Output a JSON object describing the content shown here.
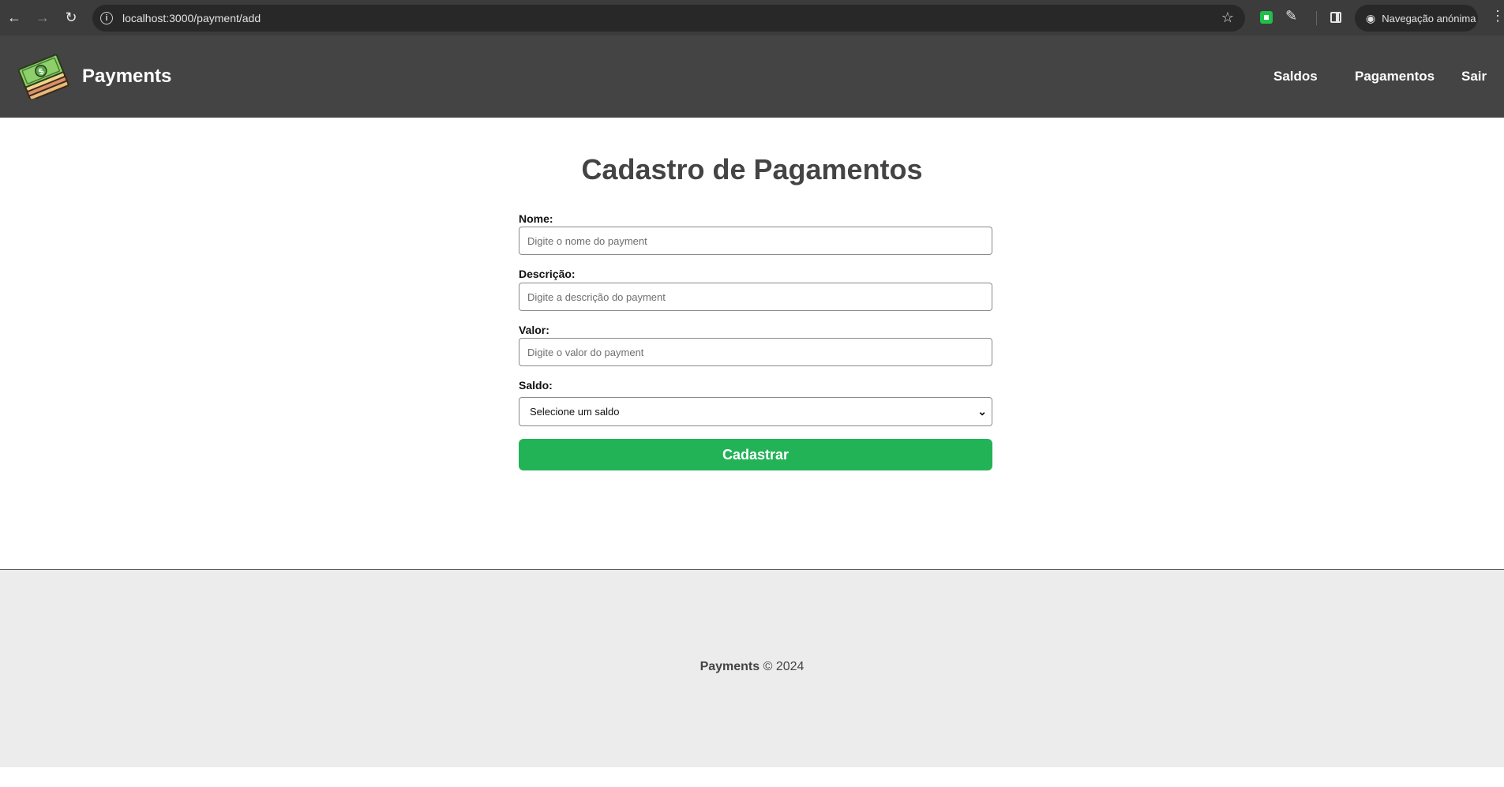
{
  "browser": {
    "url": "localhost:3000/payment/add",
    "profile_label": "Navegação anónima",
    "icons": [
      "back-arrow-icon",
      "forward-arrow-icon",
      "reload-icon",
      "site-info-icon",
      "bookmark-star-icon",
      "extension-icon",
      "puzzle-icon",
      "side-panel-icon",
      "incognito-icon",
      "more-menu-icon"
    ]
  },
  "header": {
    "brand": "Payments",
    "nav": {
      "saldos": "Saldos",
      "pagamentos": "Pagamentos",
      "sair": "Sair"
    },
    "colors": {
      "background": "#444444",
      "text": "#ffffff"
    }
  },
  "main": {
    "title": "Cadastro de Pagamentos",
    "form": {
      "nome_label": "Nome:",
      "nome_placeholder": "Digite o nome do payment",
      "descricao_label": "Descrição:",
      "descricao_placeholder": "Digite a descrição do payment",
      "valor_label": "Valor:",
      "valor_placeholder": "Digite o valor do payment",
      "saldo_label": "Saldo:",
      "saldo_selected": "Selecione um saldo",
      "submit_label": "Cadastrar"
    },
    "colors": {
      "submit": "#22b357",
      "title": "#444444"
    }
  },
  "footer": {
    "brand": "Payments",
    "copyright": "© 2024",
    "background": "#ececec"
  }
}
